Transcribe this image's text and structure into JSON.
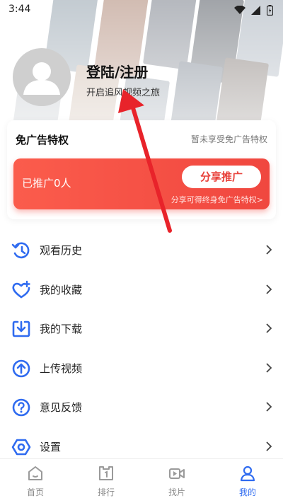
{
  "status_bar": {
    "time": "3:44"
  },
  "profile": {
    "title": "登陆/注册",
    "subtitle": "开启追风视频之旅"
  },
  "ad_card": {
    "title": "免广告特权",
    "status": "暂未享受免广告特权",
    "promo_count": "已推广0人",
    "share_button": "分享推广",
    "hint": "分享可得终身免广告特权>"
  },
  "menu": [
    {
      "label": "观看历史",
      "icon": "history-icon"
    },
    {
      "label": "我的收藏",
      "icon": "favorite-heart-icon"
    },
    {
      "label": "我的下载",
      "icon": "download-icon"
    },
    {
      "label": "上传视频",
      "icon": "upload-icon"
    },
    {
      "label": "意见反馈",
      "icon": "feedback-question-icon"
    },
    {
      "label": "设置",
      "icon": "settings-hexagon-icon"
    }
  ],
  "bottom_nav": [
    {
      "label": "首页",
      "icon": "home-icon",
      "active": false
    },
    {
      "label": "排行",
      "icon": "ranking-icon",
      "active": false
    },
    {
      "label": "找片",
      "icon": "video-camera-icon",
      "active": false
    },
    {
      "label": "我的",
      "icon": "user-icon",
      "active": true
    }
  ],
  "colors": {
    "accent_blue": "#2f6bf0",
    "promo_red": "#f0473f",
    "annotation_arrow": "#e8232a"
  }
}
